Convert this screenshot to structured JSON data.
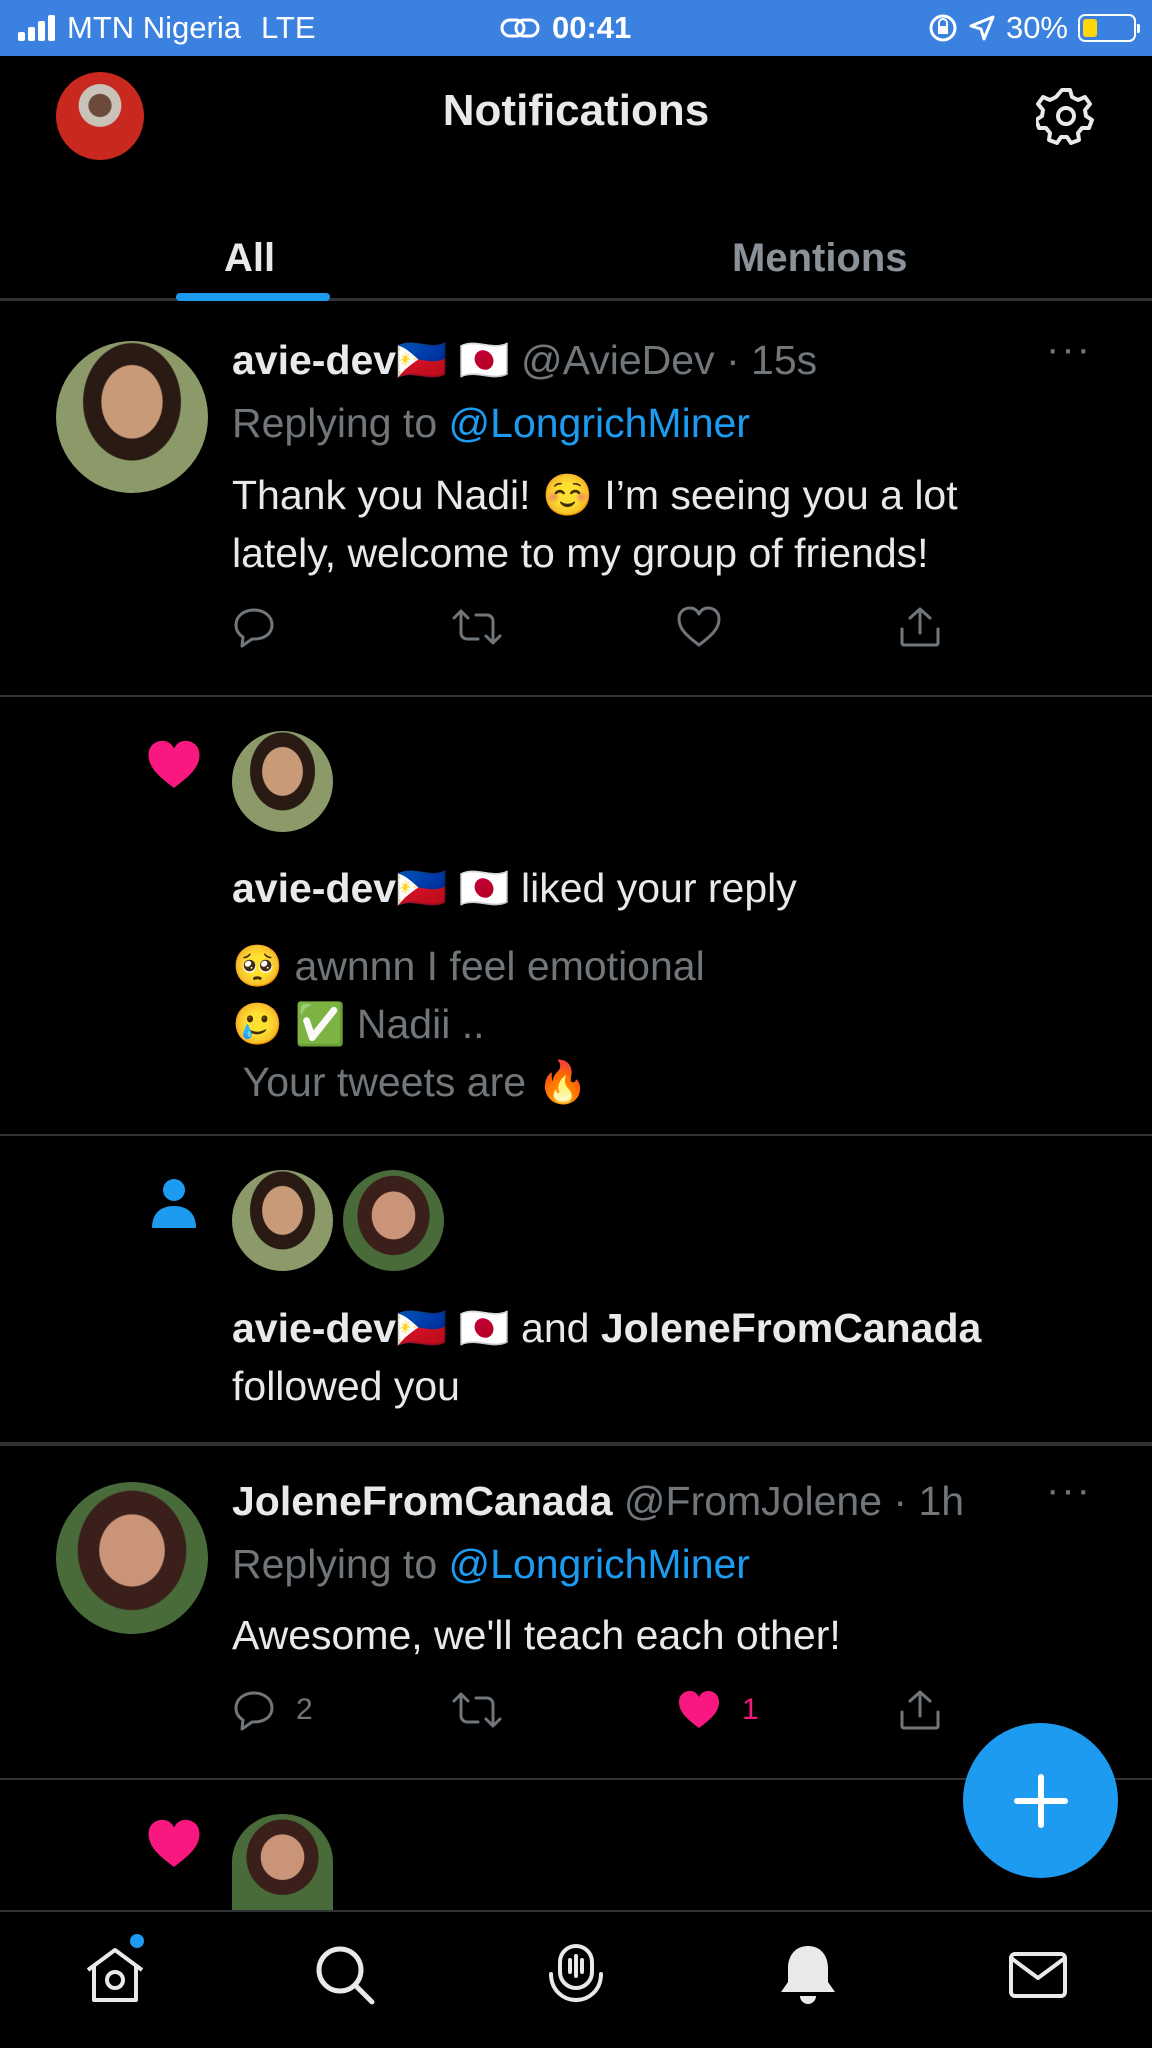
{
  "status_bar": {
    "carrier": "MTN Nigeria",
    "network": "LTE",
    "time": "00:41",
    "battery_percent": "30%",
    "battery_level": 0.3
  },
  "header": {
    "title": "Notifications",
    "tabs": [
      {
        "label": "All",
        "active": true
      },
      {
        "label": "Mentions",
        "active": false
      }
    ]
  },
  "notifications": [
    {
      "type": "reply",
      "display_name": "avie-dev",
      "flags": "🇵🇭 🇯🇵",
      "handle": "@AvieDev",
      "time": "· 15s",
      "replying_prefix": "Replying to",
      "replying_to": "@LongrichMiner",
      "text_line1": "Thank you Nadi! ☺️ I’m seeing you a lot",
      "text_line2": "lately, welcome to my group of friends!",
      "more": "···"
    },
    {
      "type": "like",
      "display_name": "avie-dev",
      "flags": "🇵🇭 🇯🇵",
      "action": "liked your reply",
      "quoted_line1": "🥺 awnnn I feel emotional",
      "quoted_line2": "🥲 ✅ Nadii ..",
      "quoted_line3": " Your tweets are 🔥"
    },
    {
      "type": "follow",
      "display_name": "avie-dev",
      "flags": "🇵🇭 🇯🇵",
      "connector": "and",
      "second_name": "JoleneFromCanada",
      "action": "followed you"
    },
    {
      "type": "reply",
      "display_name": "JoleneFromCanada",
      "handle": "@FromJolene",
      "time": "· 1h",
      "replying_prefix": "Replying to",
      "replying_to": "@LongrichMiner",
      "text_line1": "Awesome, we'll teach each other!",
      "reply_count": "2",
      "like_count": "1",
      "more": "···"
    }
  ],
  "colors": {
    "accent": "#1d9bf0",
    "like": "#f91880",
    "status_bar": "#3b82e0",
    "background": "#000000"
  },
  "icons": [
    "settings-gear-icon",
    "reply-icon",
    "retweet-icon",
    "heart-icon",
    "share-icon",
    "person-icon",
    "home-icon",
    "search-icon",
    "spaces-icon",
    "bell-icon",
    "mail-icon",
    "plus-icon"
  ]
}
